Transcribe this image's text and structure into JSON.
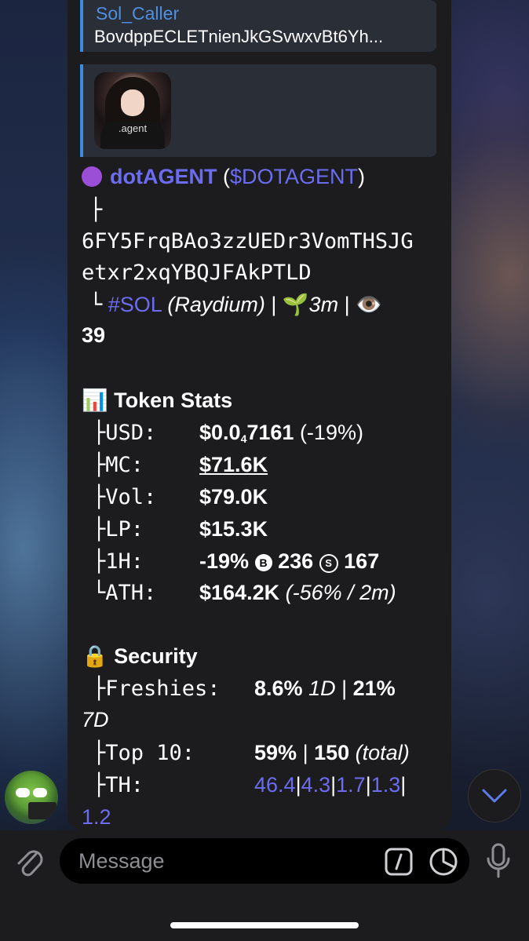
{
  "reply": {
    "name": "Sol_Caller",
    "text": "BovdppECLETnienJkGSvwxvBt6Yh..."
  },
  "media": {
    "shirt_text": ".agent"
  },
  "token": {
    "emoji_color": "#9b4fd6",
    "name": "dotAGENT",
    "ticker_open": " (",
    "ticker": "$DOTAGENT",
    "ticker_close": ")",
    "tree_top": "├",
    "address_line1": "6FY5FrqBAo3zzUEDr3VomTHSJG",
    "address_line2": "etxr2xqYBQJFAkPTLD",
    "tree_end": "└",
    "chain": "#SOL",
    "dex": "(Raydium)",
    "sep": "|",
    "age_icon": "🌱",
    "age": "3m",
    "views_icon": "👁️",
    "views": "39"
  },
  "stats": {
    "header_icon": "📊",
    "header": "Token Stats",
    "rows": [
      {
        "prefix": "├",
        "label": "USD:",
        "value_main": "$0.0",
        "value_sub": "4",
        "value_rest": "7161",
        "extra": " (-19%)"
      },
      {
        "prefix": "├",
        "label": "MC:",
        "value": "$71.6K"
      },
      {
        "prefix": "├",
        "label": "Vol:",
        "value": "$79.0K"
      },
      {
        "prefix": "├",
        "label": "LP:",
        "value": "$15.3K"
      },
      {
        "prefix": "├",
        "label": "1H:",
        "value": "-19%",
        "buy_icon": "B",
        "buys": "236",
        "sell_icon": "S",
        "sells": "167"
      },
      {
        "prefix": "└",
        "label": "ATH:",
        "value": "$164.2K",
        "extra": "(-56% / 2m)"
      }
    ]
  },
  "security": {
    "header_icon": "🔒",
    "header": "Security",
    "rows": [
      {
        "prefix": "├",
        "label": "Freshies:",
        "value": "8.6%",
        "unit1": "1D",
        "sep": "|",
        "value2": "21%",
        "unit2": "7D"
      },
      {
        "prefix": "├",
        "label": "Top 10:",
        "value": "59%",
        "sep": "|",
        "value2": "150",
        "unit2": "(total)"
      },
      {
        "prefix": "├",
        "label": "TH:",
        "values": [
          "46.4",
          "4.3",
          "1.7",
          "1.3",
          "1.2"
        ]
      }
    ]
  },
  "composer": {
    "placeholder": "Message"
  }
}
